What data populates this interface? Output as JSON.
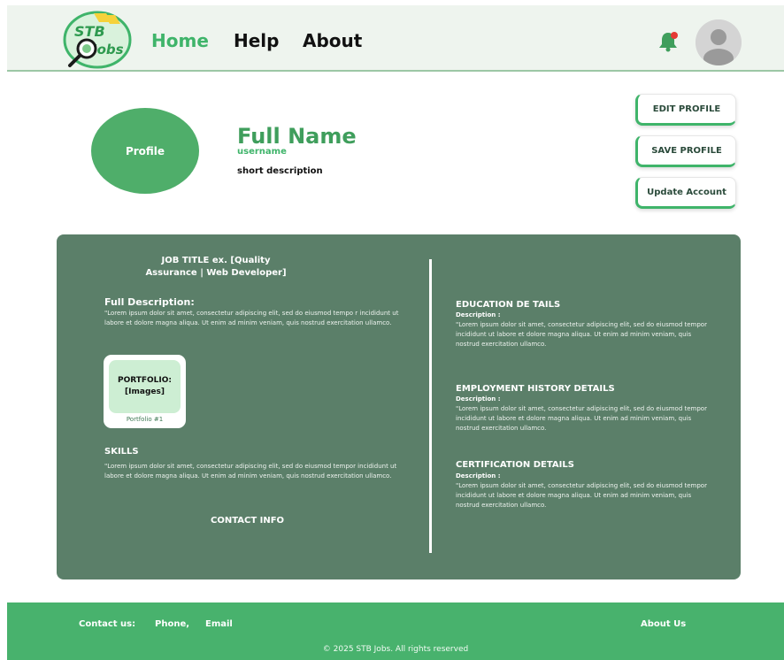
{
  "header": {
    "logo_text": "STB Jobs",
    "nav": {
      "home": "Home",
      "help": "Help",
      "about": "About"
    },
    "notification_icon": "bell-icon",
    "avatar_icon": "user-avatar-icon"
  },
  "profile": {
    "photo_label": "Profile",
    "full_name": "Full Name",
    "username": "username",
    "short_description": "short description",
    "buttons": {
      "edit": "EDIT PROFILE",
      "save": "SAVE PROFILE",
      "update": "Update Account"
    }
  },
  "details": {
    "job_title": "JOB TITLE ex. [Quality Assurance | Web Developer]",
    "full_description": {
      "heading": "Full Description:",
      "body": "\"Lorem ipsum dolor sit amet, consectetur adipiscing elit, sed do eiusmod tempo r incididunt ut labore et dolore magna aliqua. Ut enim ad minim veniam, quis nostrud exercitation ullamco."
    },
    "portfolio": {
      "label_line1": "PORTFOLIO:",
      "label_line2": "[Images]",
      "caption": "Portfolio #1"
    },
    "skills": {
      "heading": "SKILLS",
      "body": "\"Lorem ipsum dolor sit amet, consectetur adipiscing elit, sed do eiusmod tempor incididunt ut labore et dolore magna aliqua. Ut enim ad minim veniam, quis nostrud exercitation ullamco."
    },
    "contact_info": "CONTACT INFO",
    "education": {
      "heading": "EDUCATION DE TAILS",
      "sub": "Description :",
      "body": "\"Lorem ipsum dolor sit amet, consectetur adipiscing elit, sed do eiusmod tempor incididunt ut labore et dolore magna aliqua. Ut enim ad minim veniam, quis nostrud exercitation ullamco."
    },
    "employment": {
      "heading": "EMPLOYMENT HISTORY DETAILS",
      "sub": "Description :",
      "body": "\"Lorem ipsum dolor sit amet, consectetur adipiscing elit, sed do eiusmod tempor incididunt ut labore et dolore magna aliqua. Ut enim ad minim veniam, quis nostrud exercitation ullamco."
    },
    "certification": {
      "heading": "CERTIFICATION DETAILS",
      "sub": "Description :",
      "body": "\"Lorem ipsum dolor sit amet, consectetur adipiscing elit, sed do eiusmod tempor incididunt ut labore et dolore magna aliqua. Ut enim ad minim veniam, quis nostrud exercitation ullamco."
    }
  },
  "footer": {
    "contact_label": "Contact us:",
    "phone": "Phone,",
    "email": "Email",
    "about_us": "About Us",
    "copyright": "© 2025 STB Jobs. All rights reserved"
  },
  "colors": {
    "accent_green": "#3fb46a",
    "card_green": "#5b7f69",
    "footer_green": "#48b26d",
    "header_bg": "#eef4ee"
  }
}
